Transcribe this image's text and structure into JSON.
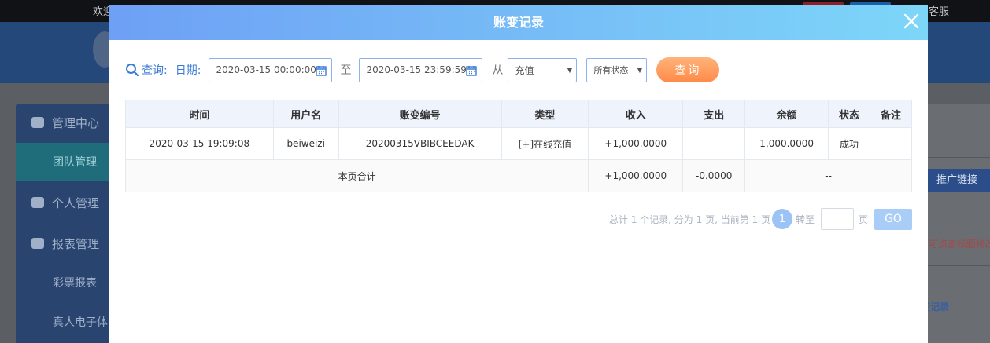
{
  "background": {
    "welcome": "欢迎",
    "service": "客服",
    "sidebar": [
      {
        "label": "管理中心"
      },
      {
        "label": "团队管理"
      },
      {
        "label": "个人管理"
      },
      {
        "label": "报表管理"
      },
      {
        "label": "彩票报表"
      },
      {
        "label": "真人电子体"
      }
    ],
    "promote_link": "推广链接",
    "hint": "可点击标题修改",
    "record_link": "变记录"
  },
  "modal": {
    "title": "账变记录",
    "close_icon": "close-icon"
  },
  "query": {
    "label": "查询:",
    "date_label": "日期:",
    "start_date": "2020-03-15 00:00:00",
    "to_label": "至",
    "end_date": "2020-03-15 23:59:59",
    "from_label": "从",
    "type_selected": "充值",
    "status_selected": "所有状态",
    "query_button": "查询"
  },
  "table": {
    "headers": [
      "时间",
      "用户名",
      "账变编号",
      "类型",
      "收入",
      "支出",
      "余额",
      "状态",
      "备注"
    ],
    "rows": [
      {
        "time": "2020-03-15 19:09:08",
        "username": "beiweizi",
        "serial": "20200315VBIBCEEDAK",
        "type": "[+]在线充值",
        "income": "+1,000.0000",
        "expense": "",
        "balance": "1,000.0000",
        "status": "成功",
        "remark": "-----"
      }
    ],
    "total": {
      "label": "本页合计",
      "income": "+1,000.0000",
      "expense": "-0.0000",
      "rest": "--"
    }
  },
  "pager": {
    "summary": "总计 1 个记录, 分为 1 页, 当前第 1 页",
    "current_page": "1",
    "goto_label": "转至",
    "page_suffix": "页",
    "go_button": "GO"
  },
  "colors": {
    "header_gradient_start": "#6ea0f5",
    "header_gradient_end": "#7dd6f8",
    "query_button": "#ff8a48",
    "income_green": "#5a9e2f",
    "link_blue": "#3b7bd6"
  }
}
